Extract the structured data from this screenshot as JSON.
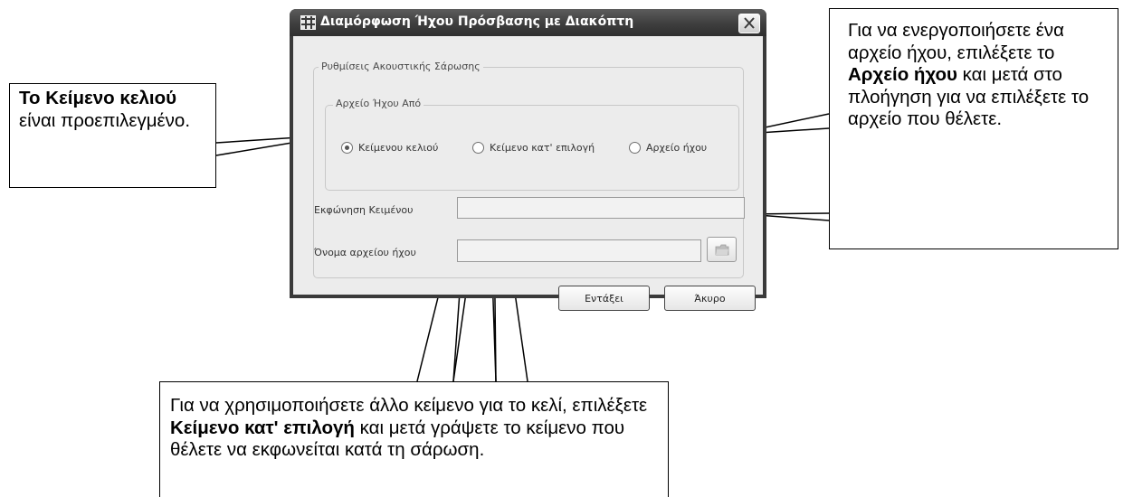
{
  "dialog": {
    "title": "Διαμόρφωση Ήχου Πρόσβασης με Διακόπτη",
    "group_scan_settings": "Ρυθμίσεις Ακουστικής Σάρωσης",
    "group_sound_source": "Αρχείο Ήχου Από",
    "radio_options": [
      {
        "label": "Κείμενου κελιού",
        "selected": true
      },
      {
        "label": "Κείμενο κατ' επιλογή",
        "selected": false
      },
      {
        "label": "Αρχείο ήχου",
        "selected": false
      }
    ],
    "speech_text_label": "Εκφώνηση Κειμένου",
    "speech_text_value": "",
    "sound_file_label": "Όνομα αρχείου ήχου",
    "sound_file_value": "",
    "ok_label": "Εντάξει",
    "cancel_label": "Άκυρο"
  },
  "callouts": {
    "left": {
      "bold": "Το Κείμενο κελιού",
      "rest": " είναι προεπιλεγμένο."
    },
    "right": {
      "p1": "Για να ενεργοποιήσετε ένα αρχείο ήχου, επιλέξετε το ",
      "bold": "Αρχείο ήχου",
      "p2": " και μετά στο πλοήγηση για να επιλέξετε το αρχείο που θέλετε."
    },
    "bottom": {
      "p1": "Για να χρησιμοποιήσετε άλλο κείμενο για το κελί, επιλέξετε ",
      "bold": "Κείμενο κατ' επιλογή",
      "p2": " και μετά γράψετε το κείμενο  που θέλετε να εκφωνείται κατά τη σάρωση."
    }
  },
  "icons": {
    "app": "grid-icon",
    "close": "close-icon",
    "browse": "folder-icon"
  }
}
